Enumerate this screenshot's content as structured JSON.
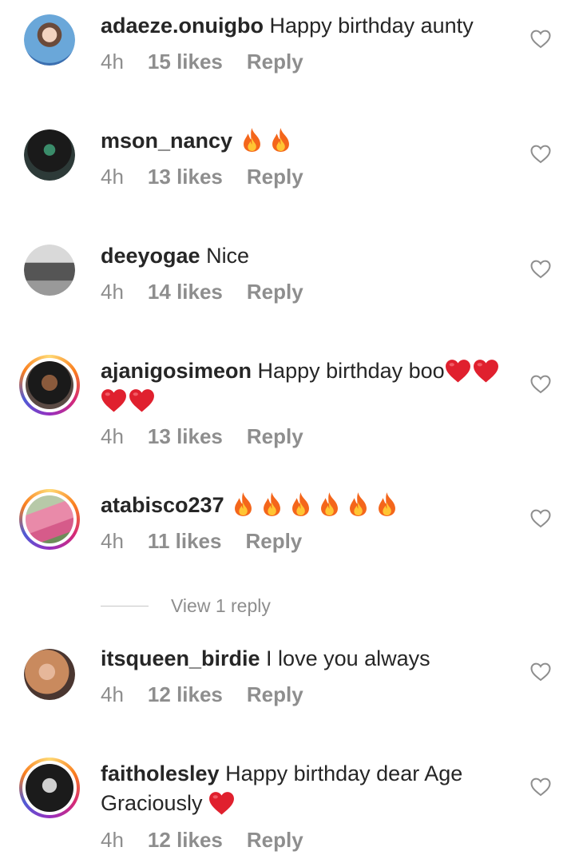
{
  "comments": [
    {
      "username": "adaeze.onuigbo",
      "text": " Happy birthday aunty",
      "time": "4h",
      "likes": "15 likes",
      "reply": "Reply",
      "emoji": []
    },
    {
      "username": "mson_nancy",
      "text": " ",
      "time": "4h",
      "likes": "13 likes",
      "reply": "Reply",
      "emoji": [
        "fire",
        "fire"
      ]
    },
    {
      "username": "deeyogae",
      "text": " Nice",
      "time": "4h",
      "likes": "14 likes",
      "reply": "Reply",
      "emoji": []
    },
    {
      "username": "ajanigosimeon",
      "text": " Happy birthday boo",
      "time": "4h",
      "likes": "13 likes",
      "reply": "Reply",
      "emoji": [
        "heart",
        "heart",
        "heart",
        "heart"
      ]
    },
    {
      "username": "atabisco237",
      "text": " ",
      "time": "4h",
      "likes": "11 likes",
      "reply": "Reply",
      "emoji": [
        "fire",
        "fire",
        "fire",
        "fire",
        "fire",
        "fire"
      ]
    },
    {
      "username": "itsqueen_birdie",
      "text": " I love you always",
      "time": "4h",
      "likes": "12 likes",
      "reply": "Reply",
      "emoji": []
    },
    {
      "username": "faitholesley",
      "text": " Happy birthday dear Age Graciously ",
      "time": "4h",
      "likes": "12 likes",
      "reply": "Reply",
      "emoji": [
        "heart"
      ]
    }
  ],
  "view_replies": "View 1 reply",
  "icons": {
    "like": "heart-outline-icon",
    "fire": "fire-emoji-icon",
    "red_heart": "red-heart-emoji-icon"
  },
  "colors": {
    "text": "#262626",
    "meta": "#8e8e8e",
    "heart_emoji": "#e0202e"
  }
}
